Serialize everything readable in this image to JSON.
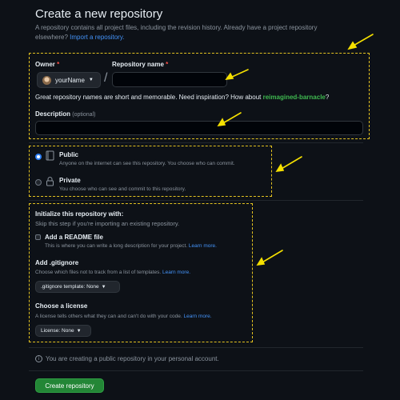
{
  "header": {
    "title": "Create a new repository",
    "intro_line1": "A repository contains all project files, including the revision history. Already have a project repository",
    "intro_line2_prefix": "elsewhere?",
    "import_link": "Import a repository."
  },
  "owner": {
    "label": "Owner",
    "required_mark": "*",
    "selected": "yourName"
  },
  "repo_name": {
    "label": "Repository name",
    "required_mark": "*",
    "separator": "/",
    "value": ""
  },
  "name_hint": {
    "text": "Great repository names are short and memorable. Need inspiration? How about",
    "suggestion": "reimagined-barnacle",
    "suffix": "?"
  },
  "description": {
    "label": "Description",
    "optional": "(optional)",
    "value": ""
  },
  "visibility": {
    "options": [
      {
        "title": "Public",
        "desc": "Anyone on the internet can see this repository. You choose who can commit.",
        "selected": true
      },
      {
        "title": "Private",
        "desc": "You choose who can see and commit to this repository.",
        "selected": false
      }
    ]
  },
  "init": {
    "heading": "Initialize this repository with:",
    "subheading": "Skip this step if you're importing an existing repository.",
    "readme": {
      "label": "Add a README file",
      "desc": "This is where you can write a long description for your project.",
      "learn": "Learn more.",
      "checked": false
    },
    "gitignore": {
      "label": "Add .gitignore",
      "desc": "Choose which files not to track from a list of templates.",
      "learn": "Learn more.",
      "button": ".gitignore template: None"
    },
    "license": {
      "label": "Choose a license",
      "desc": "A license tells others what they can and can't do with your code.",
      "learn": "Learn more.",
      "button": "License: None"
    }
  },
  "notice": {
    "text": "You are creating a public repository in your personal account."
  },
  "submit": {
    "label": "Create repository"
  },
  "colors": {
    "background": "#0d1117",
    "accent_link": "#4493f8",
    "suggestion_green": "#3fb950",
    "button_green": "#238636",
    "highlight_dashes": "#e3c220",
    "arrow_yellow": "#f5e000"
  }
}
